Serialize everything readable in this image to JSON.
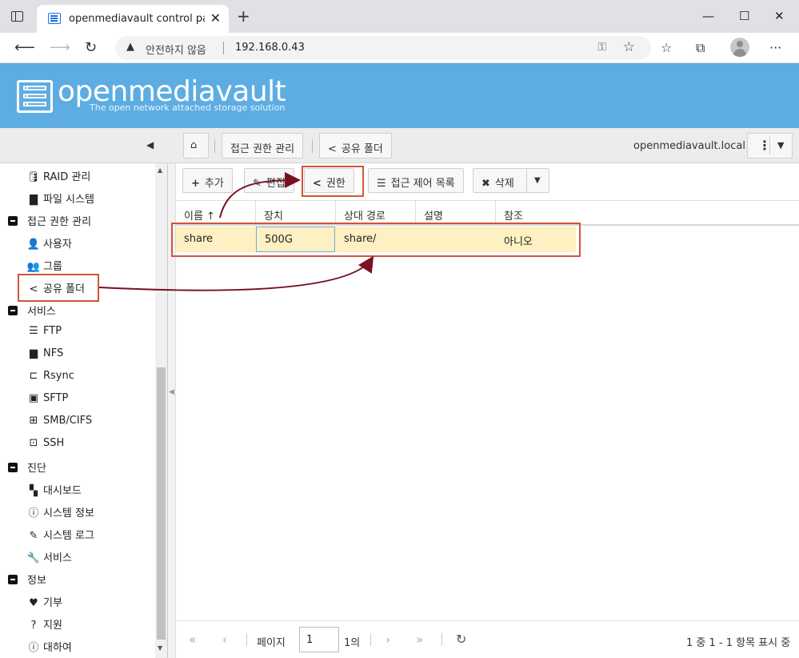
{
  "browser": {
    "tab_title": "openmediavault control panel - c",
    "tab_close": "✕",
    "new_tab": "+",
    "insecure_label": "안전하지 않음",
    "url": "192.168.0.43"
  },
  "brand": {
    "name": "openmediavault",
    "tagline": "The open network attached storage solution",
    "color": "#5dade2"
  },
  "breadcrumb": {
    "items": [
      "접근 권한 관리",
      "공유 폴더"
    ],
    "hostname": "openmediavault.local"
  },
  "sidebar": {
    "items": [
      {
        "label": "RAID 관리",
        "icon": "database-icon",
        "level": 2
      },
      {
        "label": "파일 시스템",
        "icon": "folder-icon",
        "level": 2
      },
      {
        "label": "접근 권한 관리",
        "icon": "minus-icon",
        "level": 1
      },
      {
        "label": "사용자",
        "icon": "user-icon",
        "level": 2
      },
      {
        "label": "그룹",
        "icon": "users-icon",
        "level": 2
      },
      {
        "label": "공유 폴더",
        "icon": "share-icon",
        "level": 2
      },
      {
        "label": "서비스",
        "icon": "minus-icon",
        "level": 1
      },
      {
        "label": "FTP",
        "icon": "server-icon",
        "level": 2
      },
      {
        "label": "NFS",
        "icon": "desktop-icon",
        "level": 2
      },
      {
        "label": "Rsync",
        "icon": "network-icon",
        "level": 2
      },
      {
        "label": "SFTP",
        "icon": "terminal-icon",
        "level": 2
      },
      {
        "label": "SMB/CIFS",
        "icon": "windows-icon",
        "level": 2
      },
      {
        "label": "SSH",
        "icon": "console-icon",
        "level": 2
      },
      {
        "label": "진단",
        "icon": "minus-icon",
        "level": 1
      },
      {
        "label": "대시보드",
        "icon": "dashboard-icon",
        "level": 2
      },
      {
        "label": "시스템 정보",
        "icon": "info-icon",
        "level": 2
      },
      {
        "label": "시스템 로그",
        "icon": "edit-icon",
        "level": 2
      },
      {
        "label": "서비스",
        "icon": "wrench-icon",
        "level": 2
      },
      {
        "label": "정보",
        "icon": "minus-icon",
        "level": 1
      },
      {
        "label": "기부",
        "icon": "heart-icon",
        "level": 2
      },
      {
        "label": "지원",
        "icon": "question-icon",
        "level": 2
      },
      {
        "label": "대하여",
        "icon": "info-icon",
        "level": 2
      }
    ]
  },
  "toolbar": {
    "add": "추가",
    "edit": "편집",
    "privileges": "권한",
    "acl": "접근 제어 목록",
    "delete": "삭제"
  },
  "grid": {
    "columns": [
      "이름 ↑",
      "장치",
      "상대 경로",
      "설명",
      "참조"
    ],
    "rows": [
      {
        "name": "share",
        "device": "500G",
        "path": "share/",
        "description": "",
        "referenced": "아니오"
      }
    ]
  },
  "pager": {
    "page_label": "페이지",
    "page_value": "1",
    "of_label": "1의",
    "summary": "1 중 1 - 1 항목 표시 중"
  }
}
